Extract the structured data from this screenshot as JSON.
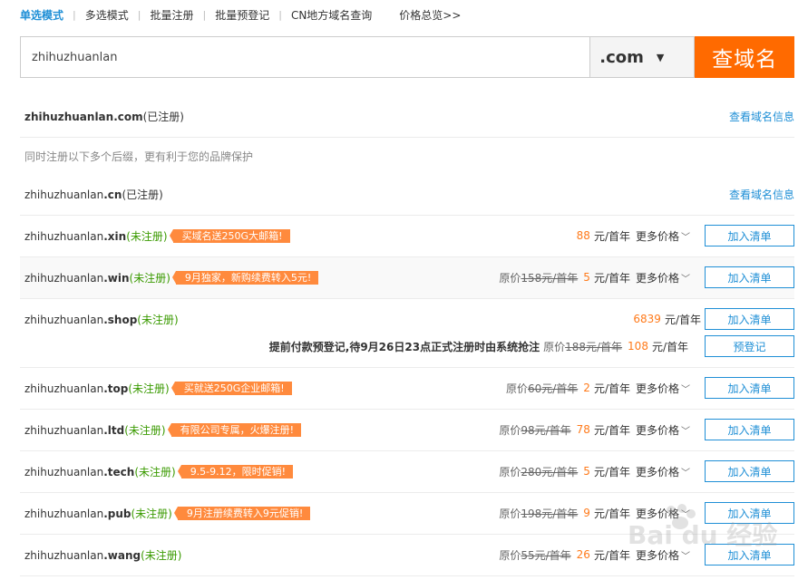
{
  "tabs": [
    "单选模式",
    "多选模式",
    "批量注册",
    "批量预登记",
    "CN地方域名查询"
  ],
  "price_overview": "价格总览>>",
  "search": {
    "value": "zhihuzhuanlan",
    "tld": ".com",
    "button": "查域名"
  },
  "primary": {
    "name": "zhihuzhuanlan.com",
    "status": "(已注册)",
    "link": "查看域名信息"
  },
  "suggest_note": "同时注册以下多个后缀，更有利于您的品牌保护",
  "cn_row": {
    "prefix": "zhihuzhuanlan",
    "tld": ".cn",
    "status": "(已注册)",
    "link": "查看域名信息"
  },
  "unreg_status": "(未注册)",
  "labels": {
    "orig_prefix": "原价",
    "unit": "元/首年",
    "more": "更多价格",
    "add": "加入清单",
    "prereg": "预登记"
  },
  "rows": [
    {
      "prefix": "zhihuzhuanlan",
      "tld": ".xin",
      "promo": "买域名送250G大邮箱!",
      "orig": "",
      "price": "88"
    },
    {
      "prefix": "zhihuzhuanlan",
      "tld": ".win",
      "promo": "9月独家，新购续费转入5元!",
      "orig": "158",
      "price": "5"
    },
    {
      "prefix": "zhihuzhuanlan",
      "tld": ".shop",
      "promo": "",
      "orig": "",
      "price": "6839",
      "prereg_note": "提前付款预登记,待9月26日23点正式注册时由系统抢注",
      "prereg_orig": "188",
      "prereg_price": "108"
    },
    {
      "prefix": "zhihuzhuanlan",
      "tld": ".top",
      "promo": "买就送250G企业邮箱!",
      "orig": "60",
      "price": "2"
    },
    {
      "prefix": "zhihuzhuanlan",
      "tld": ".ltd",
      "promo": "有限公司专属，火爆注册!",
      "orig": "98",
      "price": "78"
    },
    {
      "prefix": "zhihuzhuanlan",
      "tld": ".tech",
      "promo": "9.5-9.12，限时促销!",
      "orig": "280",
      "price": "5"
    },
    {
      "prefix": "zhihuzhuanlan",
      "tld": ".pub",
      "promo": "9月注册续费转入9元促销!",
      "orig": "198",
      "price": "9"
    },
    {
      "prefix": "zhihuzhuanlan",
      "tld": ".wang",
      "promo": "",
      "orig": "55",
      "price": "26"
    }
  ],
  "colors": {
    "accent": "#1f8fd6",
    "brand_orange": "#ff6a00",
    "available_green": "#3a9a00"
  }
}
